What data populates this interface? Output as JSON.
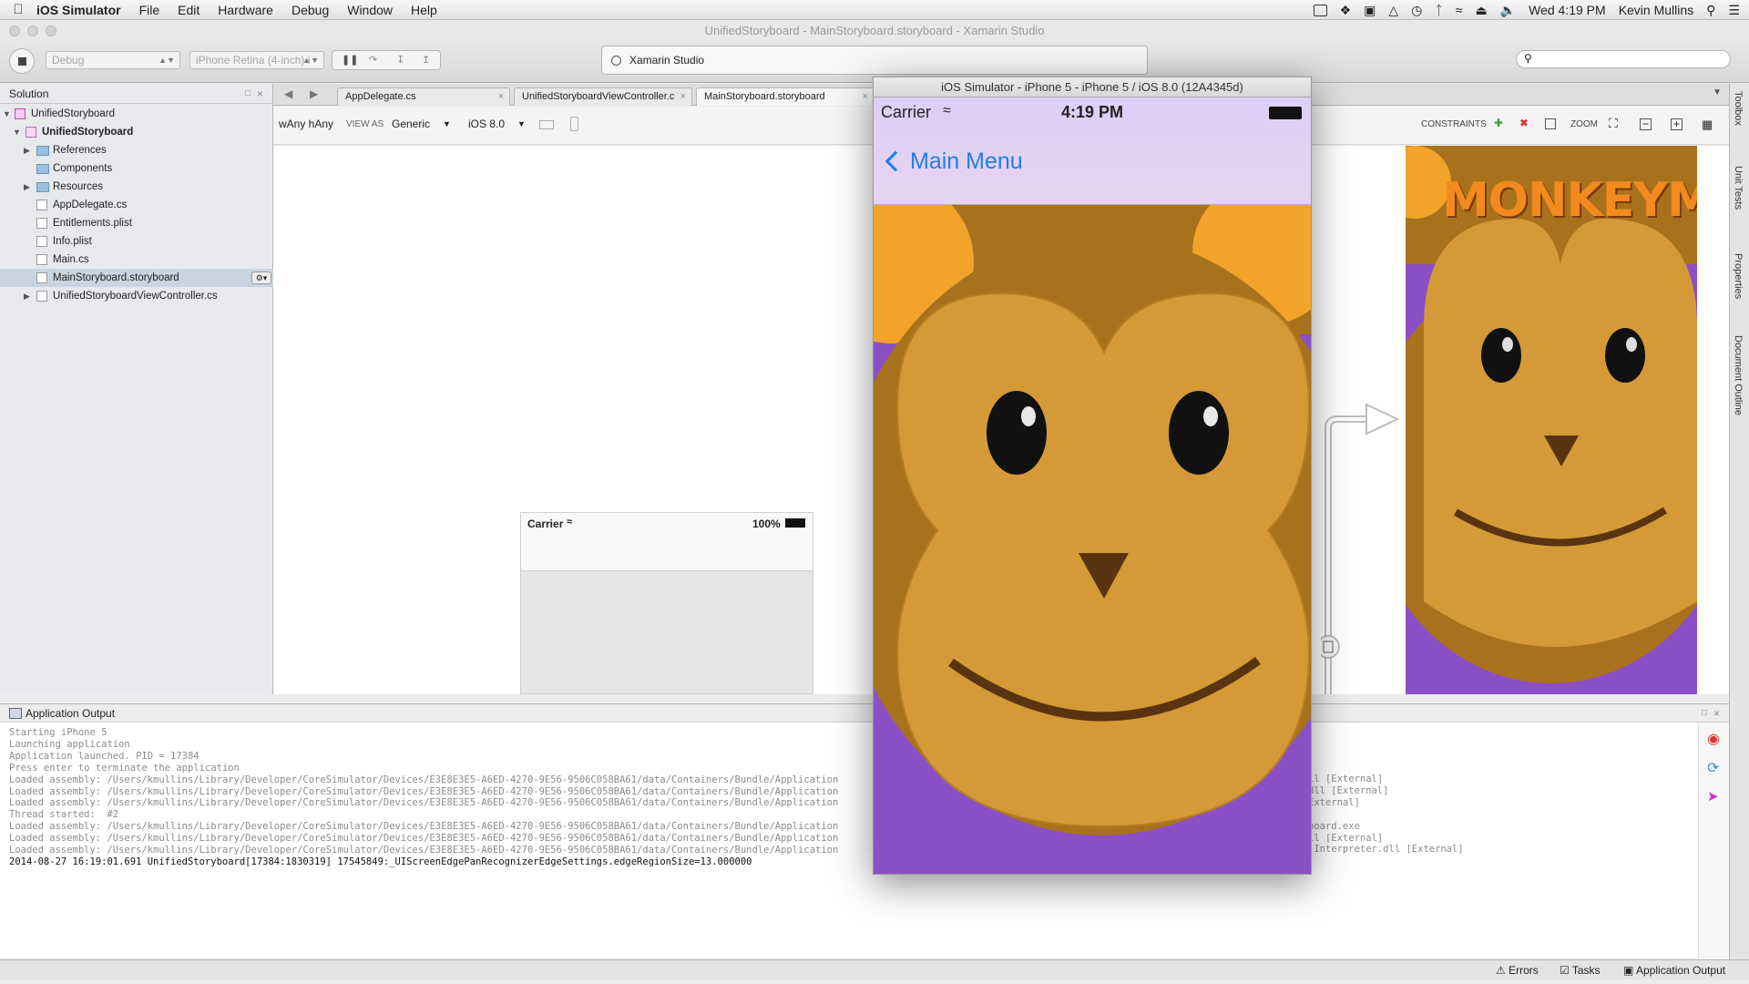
{
  "menubar": {
    "app_name": "iOS Simulator",
    "items": [
      "File",
      "Edit",
      "Hardware",
      "Debug",
      "Window",
      "Help"
    ],
    "clock": "Wed 4:19 PM",
    "user": "Kevin Mullins"
  },
  "window": {
    "title": "UnifiedStoryboard - MainStoryboard.storyboard - Xamarin Studio"
  },
  "toolbar": {
    "config": "Debug",
    "device": "iPhone Retina (4-inch) i",
    "status_text": "Xamarin Studio",
    "search_placeholder": ""
  },
  "solution": {
    "title": "Solution",
    "items": [
      {
        "label": "UnifiedStoryboard"
      },
      {
        "label": "UnifiedStoryboard"
      },
      {
        "label": "References"
      },
      {
        "label": "Components"
      },
      {
        "label": "Resources"
      },
      {
        "label": "AppDelegate.cs"
      },
      {
        "label": "Entitlements.plist"
      },
      {
        "label": "Info.plist"
      },
      {
        "label": "Main.cs"
      },
      {
        "label": "MainStoryboard.storyboard"
      },
      {
        "label": "UnifiedStoryboardViewController.cs"
      }
    ]
  },
  "tabs": [
    {
      "label": "AppDelegate.cs"
    },
    {
      "label": "UnifiedStoryboardViewController.c"
    },
    {
      "label": "MainStoryboard.storyboard"
    }
  ],
  "storyboard_toolbar": {
    "size_class": "wAny hAny",
    "view_as_label": "VIEW AS",
    "view_as_value": "Generic",
    "ios_version": "iOS 8.0",
    "constraints_label": "CONSTRAINTS",
    "zoom_label": "ZOOM"
  },
  "scene": {
    "carrier": "Carrier",
    "battery": "100%",
    "image_title": "MONKEYMA"
  },
  "right_sidebar": [
    "Toolbox",
    "Unit Tests",
    "Properties",
    "Document Outline"
  ],
  "output": {
    "title": "Application Output",
    "lines": [
      "Starting iPhone 5",
      "Launching application",
      "Application launched. PID = 17384",
      "Press enter to terminate the application",
      "Loaded assembly: /Users/kmullins/Library/Developer/CoreSimulator/Devices/E3E8E3E5-A6ED-4270-9E56-9506C058BA61/data/Containers/Bundle/Application",
      "Loaded assembly: /Users/kmullins/Library/Developer/CoreSimulator/Devices/E3E8E3E5-A6ED-4270-9E56-9506C058BA61/data/Containers/Bundle/Application",
      "Loaded assembly: /Users/kmullins/Library/Developer/CoreSimulator/Devices/E3E8E3E5-A6ED-4270-9E56-9506C058BA61/data/Containers/Bundle/Application",
      "Thread started:  #2",
      "Loaded assembly: /Users/kmullins/Library/Developer/CoreSimulator/Devices/E3E8E3E5-A6ED-4270-9E56-9506C058BA61/data/Containers/Bundle/Application",
      "Loaded assembly: /Users/kmullins/Library/Developer/CoreSimulator/Devices/E3E8E3E5-A6ED-4270-9E56-9506C058BA61/data/Containers/Bundle/Application",
      "Loaded assembly: /Users/kmullins/Library/Developer/CoreSimulator/Devices/E3E8E3E5-A6ED-4270-9E56-9506C058BA61/data/Containers/Bundle/Application"
    ],
    "last_line": "2014-08-27 16:19:01.691 UnifiedStoryboard[17384:1830319] 17545849:_UIScreenEdgePanRecognizerEdgeSettings.edgeRegionSize=13.000000",
    "right_fragments": [
      "ll [External]",
      "dll [External]",
      "External]",
      "",
      "board.exe",
      "ll [External]",
      ".Interpreter.dll [External]"
    ]
  },
  "statusbar": {
    "errors": "Errors",
    "tasks": "Tasks",
    "app_output": "Application Output"
  },
  "simulator": {
    "title": "iOS Simulator - iPhone 5 - iPhone 5 / iOS 8.0 (12A4345d)",
    "carrier": "Carrier",
    "time": "4:19 PM",
    "back_label": "Main Menu"
  },
  "colors": {
    "ios_blue": "#1f7cf0",
    "monkey_face": "#d49a38",
    "monkey_fur": "#a8721c",
    "background_purple": "#8b4fc6",
    "ear_orange": "#f2a42a"
  }
}
